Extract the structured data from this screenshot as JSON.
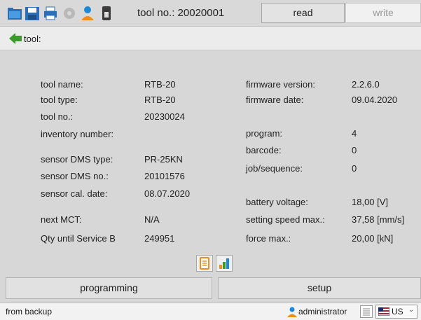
{
  "toolbar": {
    "tool_no": "tool no.: 20020001",
    "read_label": "read",
    "write_label": "write",
    "icons": [
      "folder-open-icon",
      "save-icon",
      "print-icon",
      "settings-gear-icon",
      "user-icon",
      "usb-device-icon"
    ]
  },
  "breadcrumb": {
    "text": "tool:"
  },
  "left_info": [
    {
      "label": "tool name:",
      "value": "RTB-20"
    },
    {
      "label": "tool type:",
      "value": "RTB-20"
    },
    {
      "label": "tool no.:",
      "value": "20230024"
    },
    {
      "label": "inventory number:",
      "value": ""
    },
    {
      "label": "sensor DMS type:",
      "value": "PR-25KN"
    },
    {
      "label": "sensor DMS no.:",
      "value": "20101576"
    },
    {
      "label": "sensor cal. date:",
      "value": "08.07.2020"
    },
    {
      "label": "next MCT:",
      "value": "N/A"
    },
    {
      "label": "Qty until Service B",
      "value": "249951"
    }
  ],
  "right_info": [
    {
      "label": "firmware version:",
      "value": "2.2.6.0"
    },
    {
      "label": "firmware date:",
      "value": "09.04.2020"
    },
    {
      "label": "program:",
      "value": "4"
    },
    {
      "label": "barcode:",
      "value": "0"
    },
    {
      "label": "job/sequence:",
      "value": "0"
    },
    {
      "label": "battery voltage:",
      "value": "18,00 [V]"
    },
    {
      "label": "setting speed max.:",
      "value": "37,58 [mm/s]"
    },
    {
      "label": "force max.:",
      "value": "20,00 [kN]"
    }
  ],
  "buttons": {
    "programming": "programming",
    "setup": "setup"
  },
  "status": {
    "text": "from backup",
    "user": "administrator",
    "language": "US"
  },
  "colors": {
    "accent_blue": "#1e88d8",
    "folder_blue": "#2a6fb8",
    "arrow_green": "#3a9a2a",
    "user_orange": "#f08c1c"
  }
}
